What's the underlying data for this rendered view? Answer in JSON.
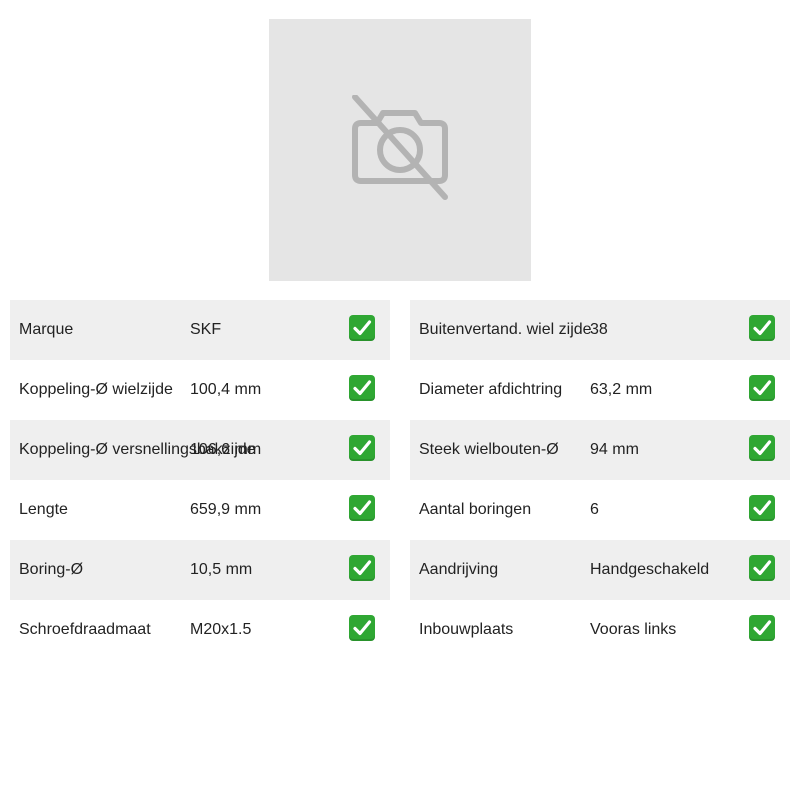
{
  "product_image": {
    "icon": "no-image-camera-icon",
    "background": "#e5e5e5",
    "icon_color": "#b3b3b3"
  },
  "check_icon": "check-mark-button-icon",
  "check_color": "#2fa733",
  "specs_left": [
    {
      "label": "Marque",
      "value": "SKF"
    },
    {
      "label": "Koppeling-Ø wielzijde",
      "value": "100,4 mm"
    },
    {
      "label": "Koppeling-Ø versnellingsbakzijde",
      "value": "106,6 mm"
    },
    {
      "label": "Lengte",
      "value": "659,9 mm"
    },
    {
      "label": "Boring-Ø",
      "value": "10,5 mm"
    },
    {
      "label": "Schroefdraadmaat",
      "value": "M20x1.5"
    }
  ],
  "specs_right": [
    {
      "label": "Buitenvertand. wiel zijde",
      "value": "38"
    },
    {
      "label": "Diameter afdichtring",
      "value": "63,2 mm"
    },
    {
      "label": "Steek wielbouten-Ø",
      "value": "94 mm"
    },
    {
      "label": "Aantal boringen",
      "value": "6"
    },
    {
      "label": "Aandrijving",
      "value": "Handgeschakeld"
    },
    {
      "label": "Inbouwplaats",
      "value": "Vooras links"
    }
  ]
}
